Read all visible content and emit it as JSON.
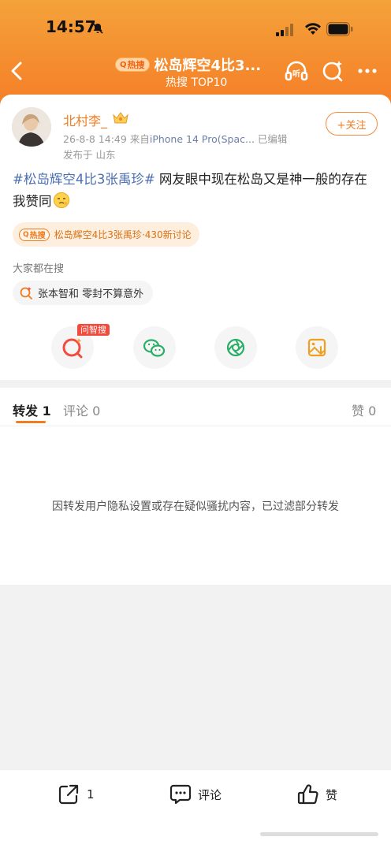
{
  "status_bar": {
    "time": "14:57"
  },
  "header": {
    "hot_tag": "热搜",
    "title": "松岛辉空4比3...",
    "subtitle": "热搜 TOP10"
  },
  "post": {
    "username": "北村李_",
    "date": "26-8-8 14:49",
    "source_prefix": "来自",
    "source_device": "iPhone 14 Pro(Spac...",
    "edited": "已编辑",
    "location": "发布于 山东",
    "follow_label": "+关注",
    "hashtag": "#松岛辉空4比3张禹珍#",
    "text": " 网友眼中现在松岛又是神一般的存在 我赞同"
  },
  "hot_pill": {
    "badge": "热搜",
    "topic": "松岛辉空4比3张禹珍",
    "discussion": "·430新讨论"
  },
  "search": {
    "label": "大家都在搜",
    "item": "张本智和 零封不算意外"
  },
  "share": {
    "zhisou_badge": "问智搜"
  },
  "tabs": [
    {
      "label": "转发",
      "count": "1"
    },
    {
      "label": "评论",
      "count": "0"
    },
    {
      "label": "赞",
      "count": "0"
    }
  ],
  "notice": "因转发用户隐私设置或存在疑似骚扰内容，已过滤部分转发",
  "bottom_bar": {
    "repost_count": "1",
    "comment_label": "评论",
    "like_label": "赞"
  },
  "colors": {
    "header_top": "#f4a23a",
    "header_bottom": "#f57e27",
    "accent": "#f27c21",
    "link": "#4b6fb0"
  }
}
